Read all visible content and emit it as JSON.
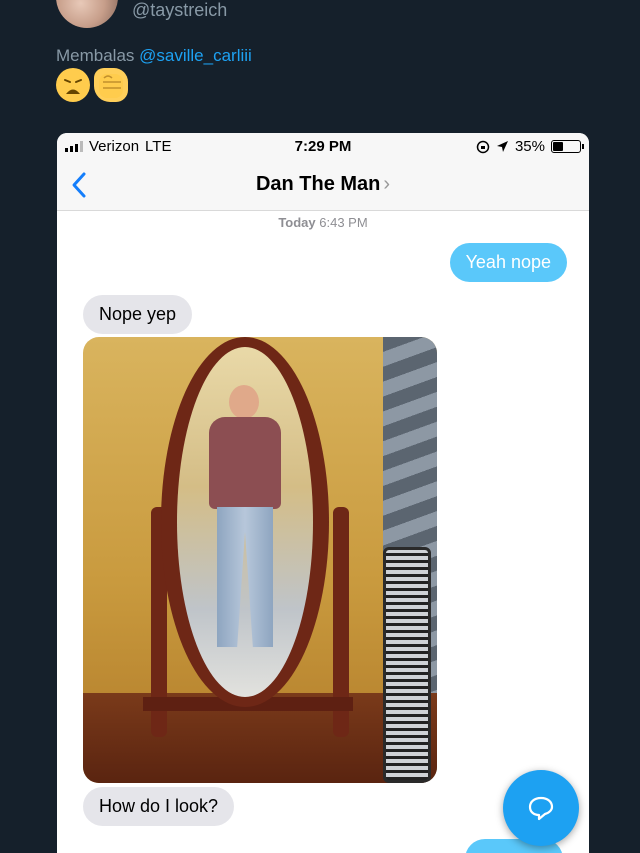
{
  "tweet": {
    "handle": "@taystreich",
    "text_prefix": "Membalas ",
    "mention": "@saville_carliii",
    "emojis": [
      "weary-face",
      "raised-fist"
    ]
  },
  "phone": {
    "status_bar": {
      "carrier": "Verizon",
      "network": "LTE",
      "time": "7:29 PM",
      "battery": "35%"
    },
    "nav": {
      "contact_name": "Dan The Man",
      "back_icon": "chevron-left-icon"
    },
    "timestamp": {
      "day": "Today",
      "time": "6:43 PM"
    },
    "messages": [
      {
        "type": "sent",
        "text": "Yeah nope"
      },
      {
        "type": "received",
        "text": "Nope yep"
      },
      {
        "type": "received-photo",
        "text": ""
      },
      {
        "type": "received",
        "text": "How do I look?"
      },
      {
        "type": "sent",
        "text": ""
      }
    ]
  },
  "colors": {
    "background": "#15202b",
    "mention": "#1da1f2",
    "sent_bubble": "#5ac8fa",
    "received_bubble": "#e5e5ea",
    "ios_blue": "#147efb",
    "fab": "#1da1f2"
  },
  "fab": {
    "icon": "compose-reply-icon"
  }
}
